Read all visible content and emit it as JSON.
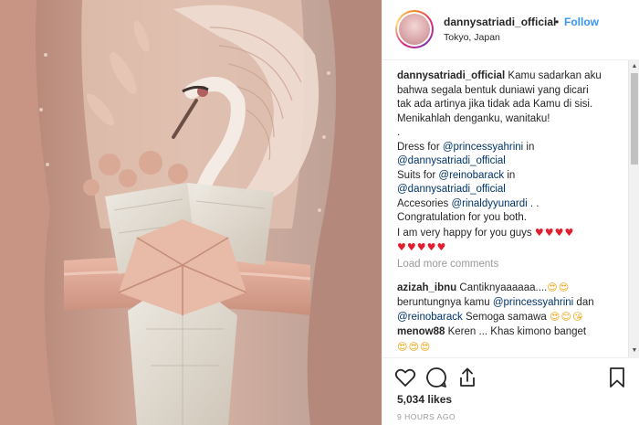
{
  "header": {
    "username": "dannysatriadi_official",
    "separator": "•",
    "follow_label": "Follow",
    "location": "Tokyo, Japan"
  },
  "caption": {
    "username": "dannysatriadi_official",
    "line1_rest": " Kamu sadarkan aku",
    "line2": "bahwa segala bentuk duniawi yang dicari",
    "line3": "tak ada artinya jika tidak ada Kamu di sisi.",
    "line4": "Menikahlah denganku, wanitaku!",
    "line5": ".",
    "dress_prefix": "Dress for ",
    "dress_mention": "@princessyahrini",
    "dress_suffix": " in",
    "dress_in_mention": "@dannysatriadi_official",
    "suits_prefix": "Suits for ",
    "suits_mention": "@reinobarack",
    "suits_suffix": " in",
    "suits_in_mention": "@dannysatriadi_official",
    "acc_prefix": "Accesories ",
    "acc_mention": "@rinaldyyunardi",
    "acc_suffix": " . .",
    "congrats": "Congratulation for you both.",
    "happy": "I am very happy for you guys ",
    "hearts_a": "♥♥♥♥",
    "hearts_b": "♥♥♥♥♥"
  },
  "load_more_label": "Load more comments",
  "comments": [
    {
      "username": "azizah_ibnu",
      "l1_text": " Cantiknyaaaaaa....",
      "l1_emoji": "😍😍",
      "l2_prefix": "beruntungnya kamu ",
      "l2_mention": "@princessyahrini",
      "l2_suffix": " dan",
      "l3_mention": "@reinobarack",
      "l3_text": " Semoga samawa ",
      "l3_emoji": "😍😊😘"
    },
    {
      "username": "menow88",
      "l1_text": " Keren ... Khas kimono banget",
      "l2_emoji": "😍😍😍"
    }
  ],
  "actions": {
    "like_icon": "heart-outline-icon",
    "comment_icon": "comment-bubble-icon",
    "share_icon": "share-upload-icon",
    "save_icon": "bookmark-icon"
  },
  "likes_label": "5,034 likes",
  "timestamp": "9 HOURS AGO",
  "colors": {
    "link_blue": "#3897f0",
    "mention_blue": "#003569",
    "muted_gray": "#999999",
    "heart_red": "#e11d2e",
    "photo_pink": "#d9a99a",
    "photo_bow": "#e3ddd2"
  }
}
